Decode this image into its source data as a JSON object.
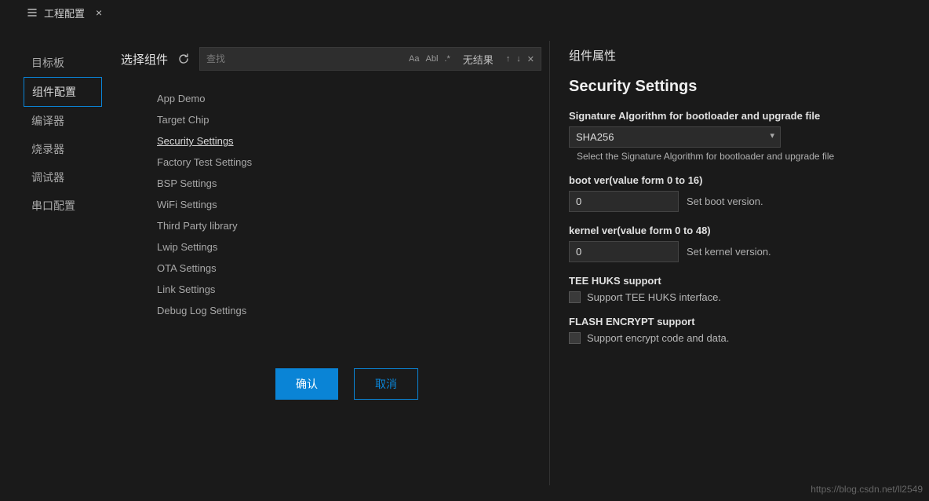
{
  "tab": {
    "title": "工程配置"
  },
  "sidebar": {
    "items": [
      {
        "label": "目标板"
      },
      {
        "label": "组件配置"
      },
      {
        "label": "编译器"
      },
      {
        "label": "烧录器"
      },
      {
        "label": "调试器"
      },
      {
        "label": "串口配置"
      }
    ],
    "active_index": 1
  },
  "center": {
    "title": "选择组件",
    "search_placeholder": "查找",
    "search_aa": "Aa",
    "search_abl": "Abl",
    "no_result": "无结果",
    "components": [
      "App Demo",
      "Target Chip",
      "Security Settings",
      "Factory Test Settings",
      "BSP Settings",
      "WiFi Settings",
      "Third Party library",
      "Lwip Settings",
      "OTA Settings",
      "Link Settings",
      "Debug Log Settings"
    ],
    "selected_index": 2,
    "confirm": "确认",
    "cancel": "取消"
  },
  "right": {
    "section": "组件属性",
    "title": "Security Settings",
    "sig_label": "Signature Algorithm for bootloader and upgrade file",
    "sig_value": "SHA256",
    "sig_help": "Select the Signature Algorithm for bootloader and upgrade file",
    "boot_label": "boot ver(value form 0 to 16)",
    "boot_value": "0",
    "boot_desc": "Set boot version.",
    "kernel_label": "kernel ver(value form 0 to 48)",
    "kernel_value": "0",
    "kernel_desc": "Set kernel version.",
    "tee_label": "TEE HUKS support",
    "tee_check": "Support TEE HUKS interface.",
    "flash_label": "FLASH ENCRYPT support",
    "flash_check": "Support encrypt code and data."
  },
  "watermark": "https://blog.csdn.net/ll2549"
}
